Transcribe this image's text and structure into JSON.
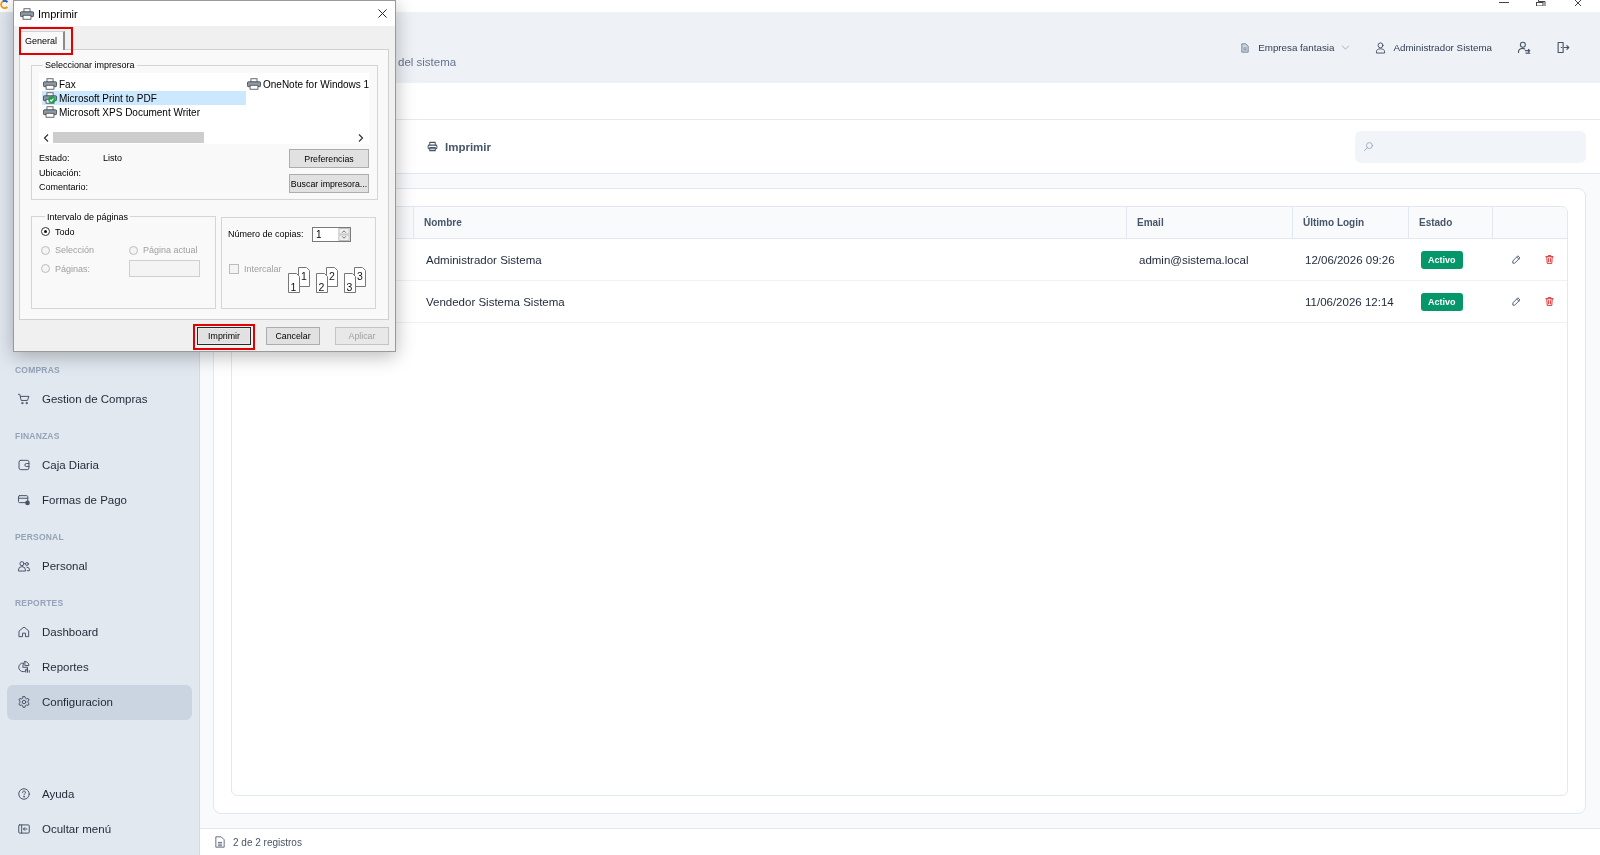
{
  "header": {
    "subtitle": "del sistema",
    "company": "Empresa fantasia",
    "user": "Administrador Sistema"
  },
  "sidebar": {
    "sections": [
      {
        "label": "COMPRAS",
        "items": [
          {
            "label": "Gestion de Compras",
            "selected": false
          }
        ]
      },
      {
        "label": "FINANZAS",
        "items": [
          {
            "label": "Caja Diaria",
            "selected": false
          },
          {
            "label": "Formas de Pago",
            "selected": false
          }
        ]
      },
      {
        "label": "PERSONAL",
        "items": [
          {
            "label": "Personal",
            "selected": false
          }
        ]
      },
      {
        "label": "REPORTES",
        "items": [
          {
            "label": "Dashboard",
            "selected": false
          },
          {
            "label": "Reportes",
            "selected": false
          },
          {
            "label": "Configuracion",
            "selected": true
          }
        ]
      }
    ],
    "bottom_items": [
      {
        "label": "Ayuda",
        "selected": false
      },
      {
        "label": "Ocultar menú",
        "selected": false
      }
    ]
  },
  "toolbar": {
    "print_button": "Imprimir"
  },
  "table": {
    "columns": [
      "Nombre",
      "Email",
      "Último Login",
      "Estado"
    ],
    "rows": [
      {
        "name": "Administrador Sistema",
        "email": "admin@sistema.local",
        "last_login": "12/06/2026 09:26",
        "status": "Activo"
      },
      {
        "name": "Vendedor Sistema Sistema",
        "last_login": "11/06/2026 12:14",
        "status": "Activo"
      }
    ]
  },
  "footer": {
    "record_count": "2 de 2 registros"
  },
  "print_dialog": {
    "title": "Imprimir",
    "tabs": [
      {
        "label": "General",
        "selected": true,
        "annotated": true
      }
    ],
    "printer_group": {
      "legend": "Seleccionar impresora",
      "printers": [
        {
          "name": "Fax",
          "selected": false,
          "default": false
        },
        {
          "name": "Microsoft Print to PDF",
          "selected": true,
          "default": true
        },
        {
          "name": "Microsoft XPS Document Writer",
          "selected": false,
          "default": false
        },
        {
          "name": "OneNote for Windows 1",
          "selected": false,
          "default": false
        }
      ],
      "info": [
        {
          "label": "Estado:",
          "value": "Listo"
        },
        {
          "label": "Ubicación:"
        },
        {
          "label": "Comentario:"
        }
      ],
      "buttons": [
        "Preferencias",
        "Buscar impresora..."
      ]
    },
    "range_group": {
      "legend": "Intervalo de páginas",
      "options": [
        {
          "label": "Todo",
          "selected": true,
          "disabled": false
        },
        {
          "label": "Selección",
          "selected": false,
          "disabled": true
        },
        {
          "label": "Página actual",
          "selected": false,
          "disabled": true
        },
        {
          "label": "Páginas:",
          "selected": false,
          "disabled": true
        }
      ],
      "pages_field": {
        "disabled": true
      }
    },
    "copies_group": {
      "label": "Número de copias:",
      "value": "1",
      "collate": {
        "label": "Intercalar",
        "checked": false,
        "disabled": true
      },
      "collate_preview": [
        {
          "front": "1",
          "back": "1"
        },
        {
          "front": "2",
          "back": "2"
        },
        {
          "front": "3",
          "back": "3"
        }
      ]
    },
    "buttons": [
      {
        "label": "Imprimir",
        "kind": "default",
        "disabled": false,
        "annotated": true
      },
      {
        "label": "Cancelar",
        "kind": "normal",
        "disabled": false,
        "annotated": false
      },
      {
        "label": "Aplicar",
        "kind": "normal",
        "disabled": true,
        "annotated": false
      }
    ]
  }
}
